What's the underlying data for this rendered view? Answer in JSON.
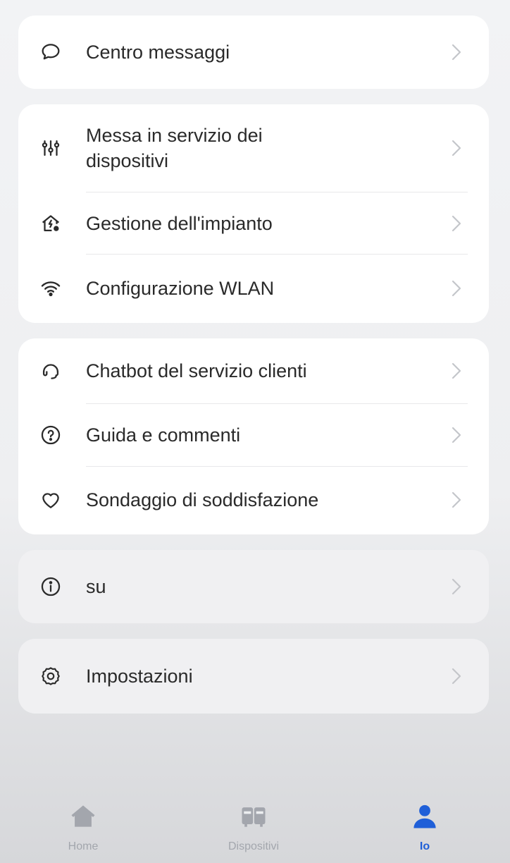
{
  "groups": [
    {
      "items": [
        {
          "label": "Centro messaggi",
          "icon": "message-bubble-icon"
        }
      ]
    },
    {
      "items": [
        {
          "label": "Messa in servizio dei dispositivi",
          "icon": "sliders-icon"
        },
        {
          "label": "Gestione dell'impianto",
          "icon": "home-power-icon"
        },
        {
          "label": "Configurazione WLAN",
          "icon": "wifi-icon"
        }
      ]
    },
    {
      "items": [
        {
          "label": "Chatbot del servizio clienti",
          "icon": "headset-icon"
        },
        {
          "label": "Guida e commenti",
          "icon": "help-circle-icon"
        },
        {
          "label": "Sondaggio di soddisfazione",
          "icon": "heart-icon"
        }
      ]
    },
    {
      "items": [
        {
          "label": "su",
          "icon": "info-circle-icon"
        }
      ]
    },
    {
      "items": [
        {
          "label": "Impostazioni",
          "icon": "gear-icon"
        }
      ]
    }
  ],
  "tabbar": {
    "tabs": [
      {
        "label": "Home",
        "icon": "home-icon",
        "active": false
      },
      {
        "label": "Dispositivi",
        "icon": "devices-icon",
        "active": false
      },
      {
        "label": "Io",
        "icon": "person-icon",
        "active": true
      }
    ]
  },
  "colors": {
    "accent": "#1f5fd8",
    "inactive_tab": "#a3a6ad",
    "text": "#2a2a2a",
    "chevron": "#c4c6ca"
  }
}
